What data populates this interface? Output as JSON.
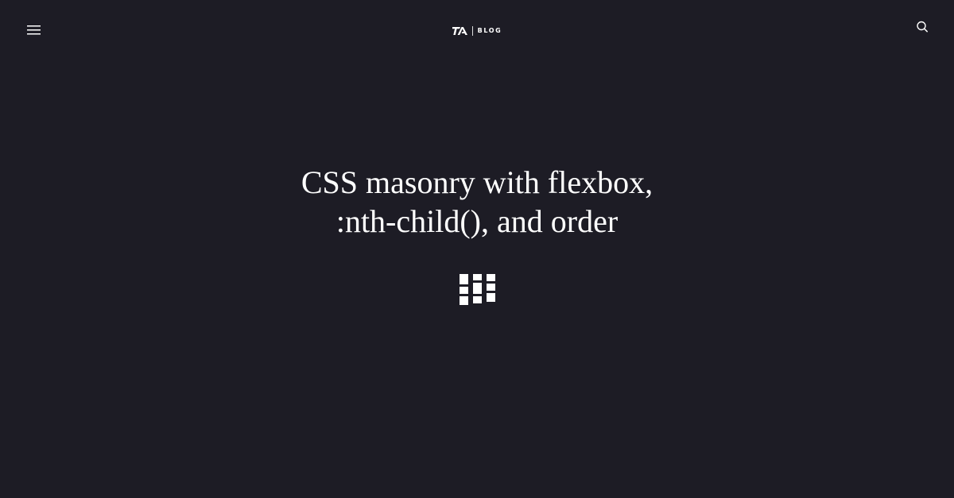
{
  "header": {
    "menu_icon": "hamburger-menu-icon",
    "brand": {
      "logo_icon": "ta-logo-icon",
      "label": "BLOG"
    },
    "search_icon": "search-icon"
  },
  "post": {
    "title_line1": "CSS masonry with flexbox,",
    "title_line2": ":nth-child(), and order",
    "illustration_icon": "masonry-grid-icon"
  },
  "colors": {
    "background": "#1d1c25",
    "foreground": "#ffffff"
  }
}
